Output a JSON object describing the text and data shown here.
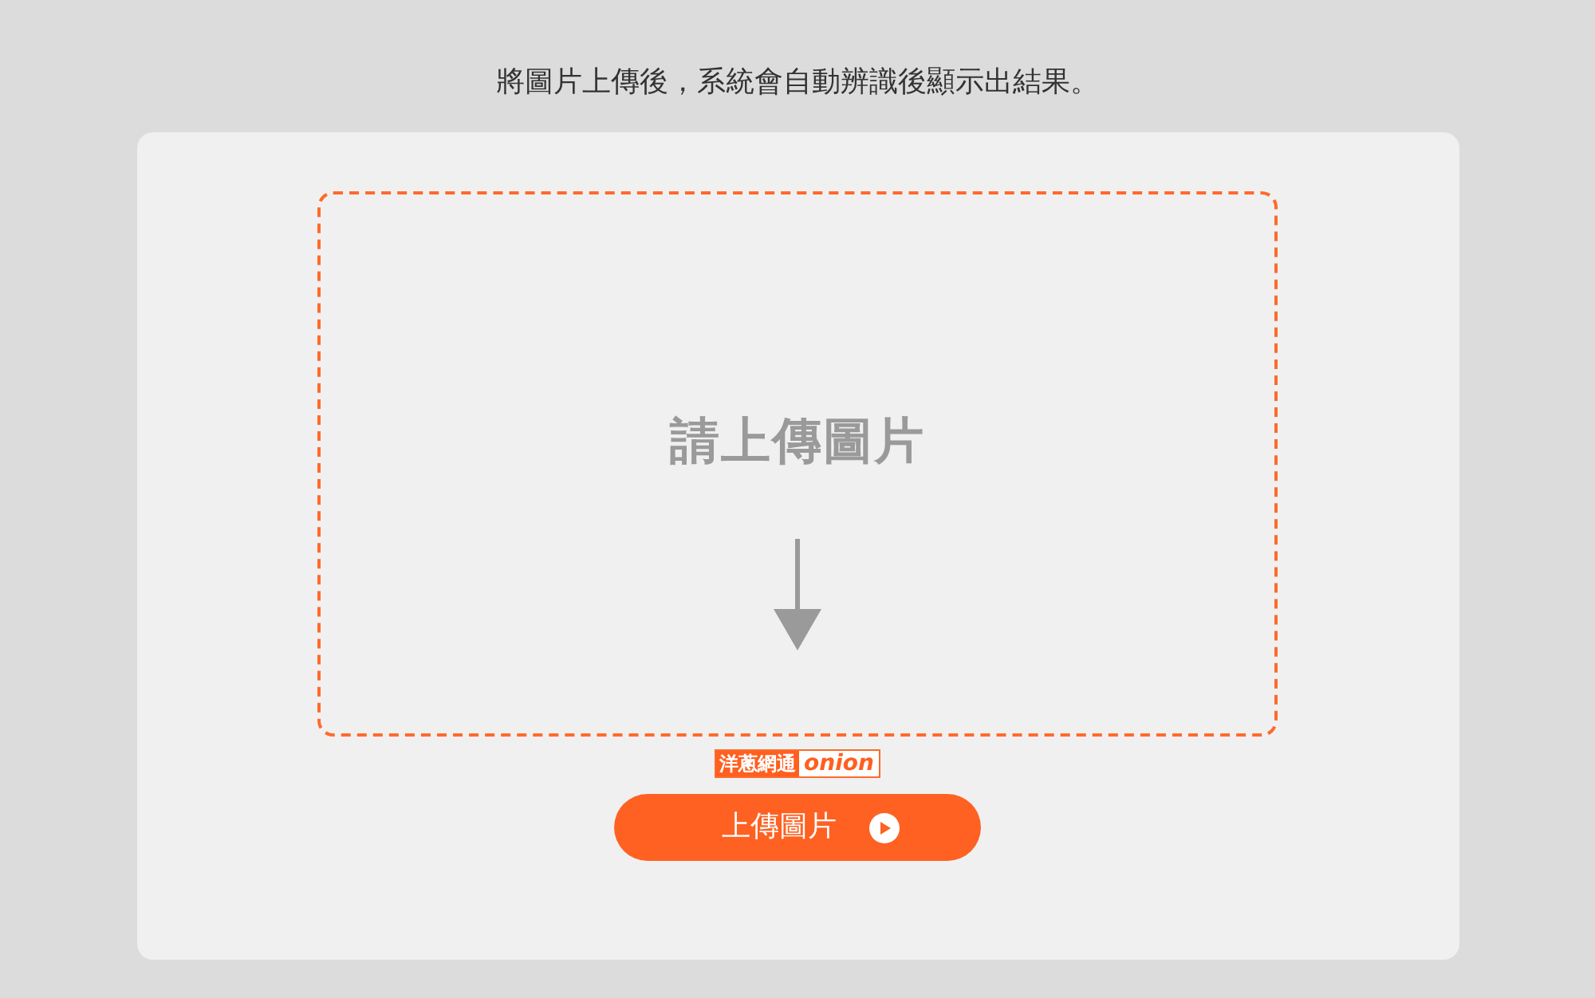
{
  "caption": "將圖片上傳後，系統會自動辨識後顯示出結果。",
  "dropzone": {
    "prompt": "請上傳圖片"
  },
  "logo": {
    "name": "洋蔥網通",
    "mark": "onion"
  },
  "upload_button": {
    "label": "上傳圖片"
  }
}
